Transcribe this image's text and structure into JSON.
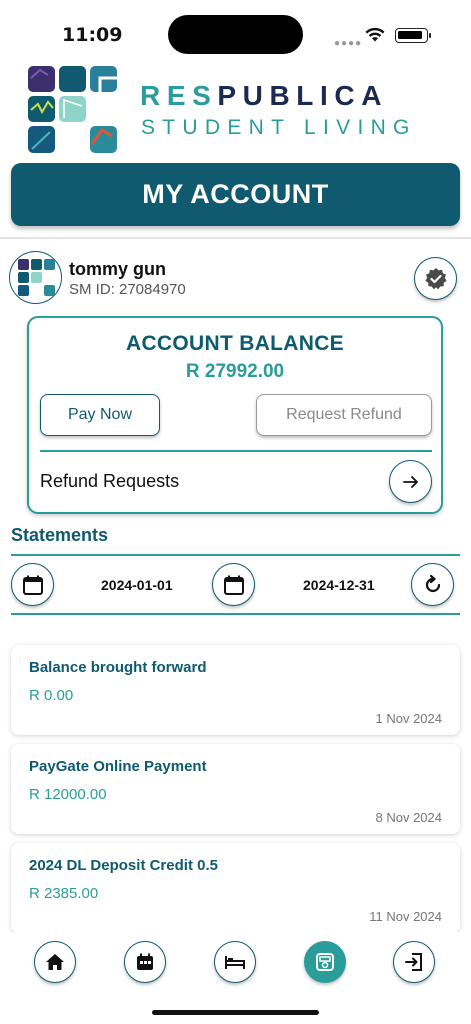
{
  "status_bar": {
    "time": "11:09"
  },
  "brand": {
    "name_part1": "RES",
    "name_part2": "PUBLICA",
    "subtitle": "STUDENT LIVING"
  },
  "header": {
    "title": "MY ACCOUNT"
  },
  "user": {
    "name": "tommy gun",
    "sm_id": "SM ID: 27084970"
  },
  "balance": {
    "title": "ACCOUNT BALANCE",
    "amount": "R 27992.00",
    "pay_now_label": "Pay Now",
    "request_refund_label": "Request Refund",
    "refund_requests_label": "Refund Requests"
  },
  "statements": {
    "title": "Statements",
    "start_date": "2024-01-01",
    "end_date": "2024-12-31"
  },
  "transactions": [
    {
      "title": "Balance brought forward",
      "amount": "R 0.00",
      "date": "1 Nov 2024"
    },
    {
      "title": "PayGate Online Payment",
      "amount": "R 12000.00",
      "date": "8 Nov 2024"
    },
    {
      "title": "2024 DL Deposit Credit 0.5",
      "amount": "R 2385.00",
      "date": "11 Nov 2024"
    }
  ],
  "nav": {
    "items": [
      {
        "icon": "home-icon",
        "active": false
      },
      {
        "icon": "calendar-icon",
        "active": false
      },
      {
        "icon": "bed-icon",
        "active": false
      },
      {
        "icon": "cash-register-icon",
        "active": true
      },
      {
        "icon": "logout-icon",
        "active": false
      }
    ]
  },
  "colors": {
    "primary": "#0f5a6e",
    "accent": "#2a9d9a",
    "brand_dark": "#1b2a52"
  }
}
